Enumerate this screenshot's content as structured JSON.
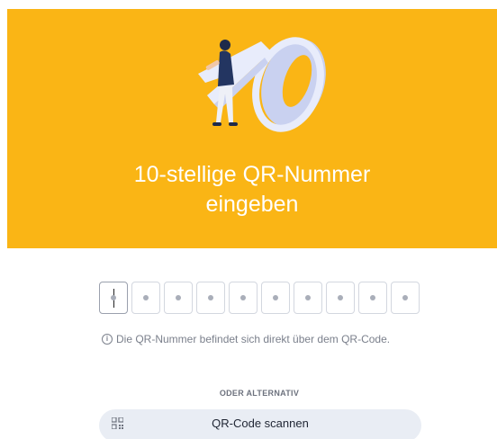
{
  "hero": {
    "title_line1": "10-stellige QR-Nummer",
    "title_line2": "eingeben",
    "background_color": "#fab515",
    "illustration": "person-carrying-number-10-illustration"
  },
  "code_input": {
    "digit_count": 10,
    "digits": [
      "",
      "",
      "",
      "",
      "",
      "",
      "",
      "",
      "",
      ""
    ],
    "active_index": 0
  },
  "hint": {
    "icon": "info-icon",
    "text": "Die QR-Nummer befindet sich direkt über dem QR-Code."
  },
  "alternative": {
    "label": "ODER ALTERNATIV",
    "scan_button_label": "QR-Code scannen",
    "scan_button_icon": "qr-code-icon"
  }
}
